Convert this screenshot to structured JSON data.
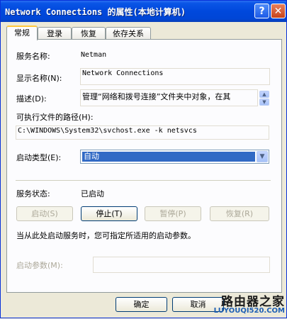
{
  "window": {
    "title": "Network Connections 的属性(本地计算机)",
    "help_glyph": "?",
    "close_glyph": "✕"
  },
  "tabs": [
    {
      "label": "常规"
    },
    {
      "label": "登录"
    },
    {
      "label": "恢复"
    },
    {
      "label": "依存关系"
    }
  ],
  "general": {
    "service_name_label": "服务名称:",
    "service_name_value": "Netman",
    "display_name_label": "显示名称(N):",
    "display_name_value": "Network Connections",
    "description_label": "描述(D):",
    "description_value": "管理“网络和拨号连接”文件夹中对象，在其",
    "exe_path_label": "可执行文件的路径(H):",
    "exe_path_value": "C:\\WINDOWS\\System32\\svchost.exe -k netsvcs",
    "startup_type_label": "启动类型(E):",
    "startup_type_value": "自动",
    "status_label": "服务状态:",
    "status_value": "已启动",
    "start_button": "启动(S)",
    "stop_button": "停止(T)",
    "pause_button": "暂停(P)",
    "resume_button": "恢复(R)",
    "hint_text": "当从此处启动服务时，您可指定所适用的启动参数。",
    "start_params_label": "启动参数(M):",
    "start_params_value": ""
  },
  "footer": {
    "ok_button": "确定",
    "cancel_button": "取消"
  },
  "watermark": {
    "main": "路由器之家",
    "url": "LUYOUQI520.COM"
  }
}
